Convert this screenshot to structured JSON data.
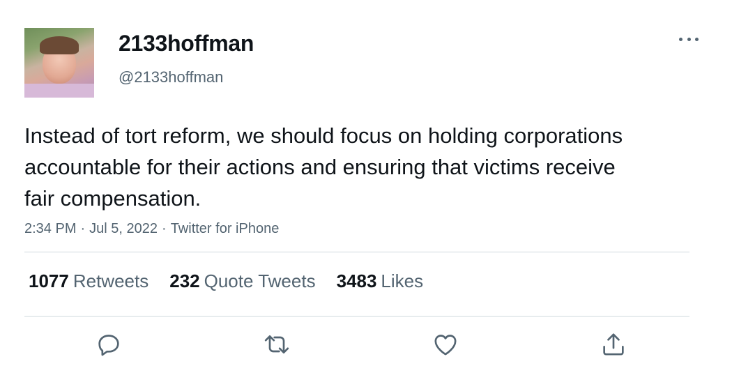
{
  "user": {
    "display_name": "2133hoffman",
    "handle": "@2133hoffman",
    "avatar_icon": "profile-photo"
  },
  "tweet": {
    "text": "Instead of tort reform, we should focus on holding corporations accountable for their actions and ensuring that victims receive fair compensation.",
    "time": "2:34 PM",
    "date": "Jul 5, 2022",
    "separator": "·",
    "source": "Twitter for iPhone"
  },
  "stats": {
    "retweets": {
      "count": "1077",
      "label": "Retweets"
    },
    "quotes": {
      "count": "232",
      "label": "Quote Tweets"
    },
    "likes": {
      "count": "3483",
      "label": "Likes"
    }
  },
  "actions": [
    "reply-icon",
    "retweet-icon",
    "like-icon",
    "share-icon"
  ],
  "colors": {
    "text_primary": "#0f1419",
    "text_secondary": "#536471",
    "divider": "#cfd9de",
    "icon": "#536471"
  }
}
